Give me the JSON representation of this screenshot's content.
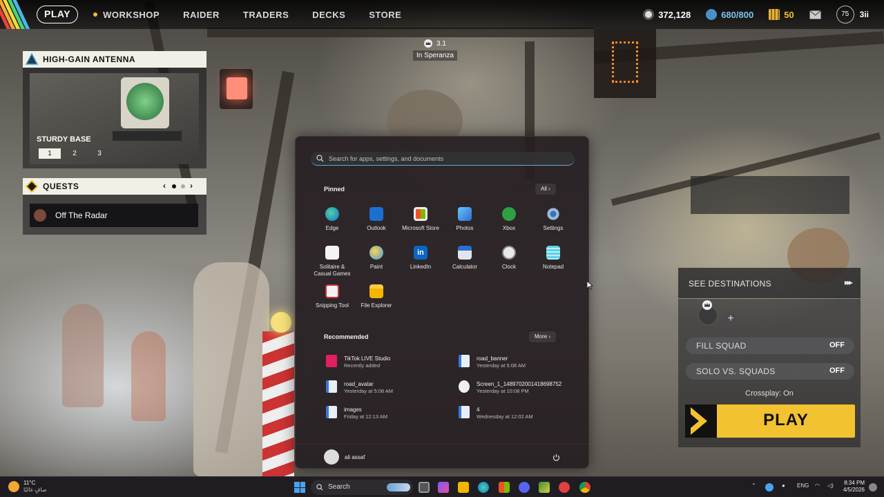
{
  "topbar": {
    "play": "PLAY",
    "nav": [
      "WORKSHOP",
      "RAIDER",
      "TRADERS",
      "DECKS",
      "STORE"
    ],
    "currencies": {
      "coins": "372,128",
      "tokens": "680/800",
      "credits": "50"
    },
    "level": "75",
    "player_tag": "3ii"
  },
  "overlay": {
    "friends_count": "3.1",
    "location": "In Speranza"
  },
  "antenna": {
    "title": "HIGH-GAIN ANTENNA",
    "label": "STURDY BASE",
    "tabs": [
      "1",
      "2",
      "3"
    ]
  },
  "quests": {
    "title": "QUESTS",
    "item": "Off The Radar"
  },
  "start_menu": {
    "search_placeholder": "Search for apps, settings, and documents",
    "pinned_title": "Pinned",
    "all_label": "All",
    "pinned": [
      {
        "label": "Edge",
        "icon": "edge-icon"
      },
      {
        "label": "Outlook",
        "icon": "outlook-icon"
      },
      {
        "label": "Microsoft Store",
        "icon": "store-icon"
      },
      {
        "label": "Photos",
        "icon": "photos-icon"
      },
      {
        "label": "Xbox",
        "icon": "xbox-icon"
      },
      {
        "label": "Settings",
        "icon": "gear-icon"
      },
      {
        "label": "Solitaire &\nCasual Games",
        "icon": "solitaire-icon"
      },
      {
        "label": "Paint",
        "icon": "paint-icon"
      },
      {
        "label": "LinkedIn",
        "icon": "linkedin-icon"
      },
      {
        "label": "Calculator",
        "icon": "calculator-icon"
      },
      {
        "label": "Clock",
        "icon": "clock-icon"
      },
      {
        "label": "Notepad",
        "icon": "notepad-icon"
      },
      {
        "label": "Snipping Tool",
        "icon": "snipping-tool-icon"
      },
      {
        "label": "File Explorer",
        "icon": "folder-icon"
      }
    ],
    "recommended_title": "Recommended",
    "more_label": "More",
    "recommended": [
      {
        "name": "TikTok LIVE Studio",
        "sub": "Recently added"
      },
      {
        "name": "road_banner",
        "sub": "Yesterday at 5:08 AM"
      },
      {
        "name": "road_avatar",
        "sub": "Yesterday at 5:08 AM"
      },
      {
        "name": "Screen_1_1489702001418698752",
        "sub": "Yesterday at 10:08 PM"
      },
      {
        "name": "images",
        "sub": "Friday at 12:13 AM"
      },
      {
        "name": "4",
        "sub": "Wednesday at 12:02 AM"
      }
    ],
    "user": "ali assaf"
  },
  "right_panel": {
    "destinations": "SEE DESTINATIONS",
    "fill_squad": {
      "label": "FILL SQUAD",
      "value": "OFF"
    },
    "solo_vs_squads": {
      "label": "SOLO VS. SQUADS",
      "value": "OFF"
    },
    "crossplay": "Crossplay: On",
    "play": "PLAY"
  },
  "taskbar": {
    "weather_temp": "11°C",
    "weather_desc": "صافٍ غالبًا",
    "search": "Search",
    "lang": "ENG",
    "time": "8:34 PM",
    "date": "4/5/2026"
  },
  "colors": {
    "accent_yellow": "#f2c230",
    "start_bg": "#261e22",
    "win_blue": "#3a8ee6"
  }
}
